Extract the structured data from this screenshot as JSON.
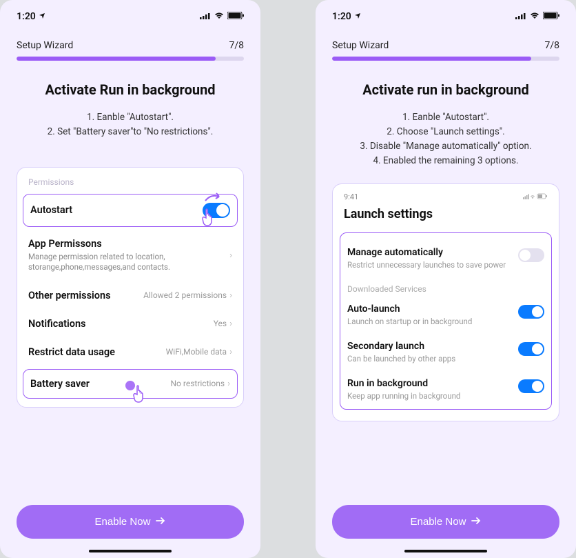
{
  "status": {
    "time": "1:20"
  },
  "wizard": {
    "label": "Setup Wizard",
    "step": "7/8"
  },
  "left": {
    "title": "Activate Run in background",
    "steps": "1.  Eanble \"Autostart\".\n2.  Set \"Battery saver\"to \"No restrictions\".",
    "card_header": "Permissions",
    "autostart": "Autostart",
    "app_perm_title": "App Permissons",
    "app_perm_sub": "Manage permission related to location, storange,phone,messages,and contacts.",
    "other_perm": "Other permissions",
    "other_perm_val": "Allowed 2 permissions",
    "notif": "Notifications",
    "notif_val": "Yes",
    "restrict": "Restrict data usage",
    "restrict_val": "WiFi,Mobile data",
    "battery": "Battery saver",
    "battery_val": "No restrictions"
  },
  "right": {
    "title": "Activate run in background",
    "steps": "1.  Eanble \"Autostart\".\n2.  Choose \"Launch settings\".\n3.  Disable \"Manage automatically\" option.\n4.  Enabled the remaining 3 options.",
    "inner_time": "9:41",
    "inner_title": "Launch settings",
    "ma_title": "Manage automatically",
    "ma_sub": "Restrict unnecessary launches to save power",
    "dl_label": "Downloaded Services",
    "al_title": "Auto-launch",
    "al_sub": "Launch on startup or in background",
    "sl_title": "Secondary launch",
    "sl_sub": "Can be launched by other apps",
    "rb_title": "Run in background",
    "rb_sub": "Keep app running in background"
  },
  "cta": "Enable Now"
}
